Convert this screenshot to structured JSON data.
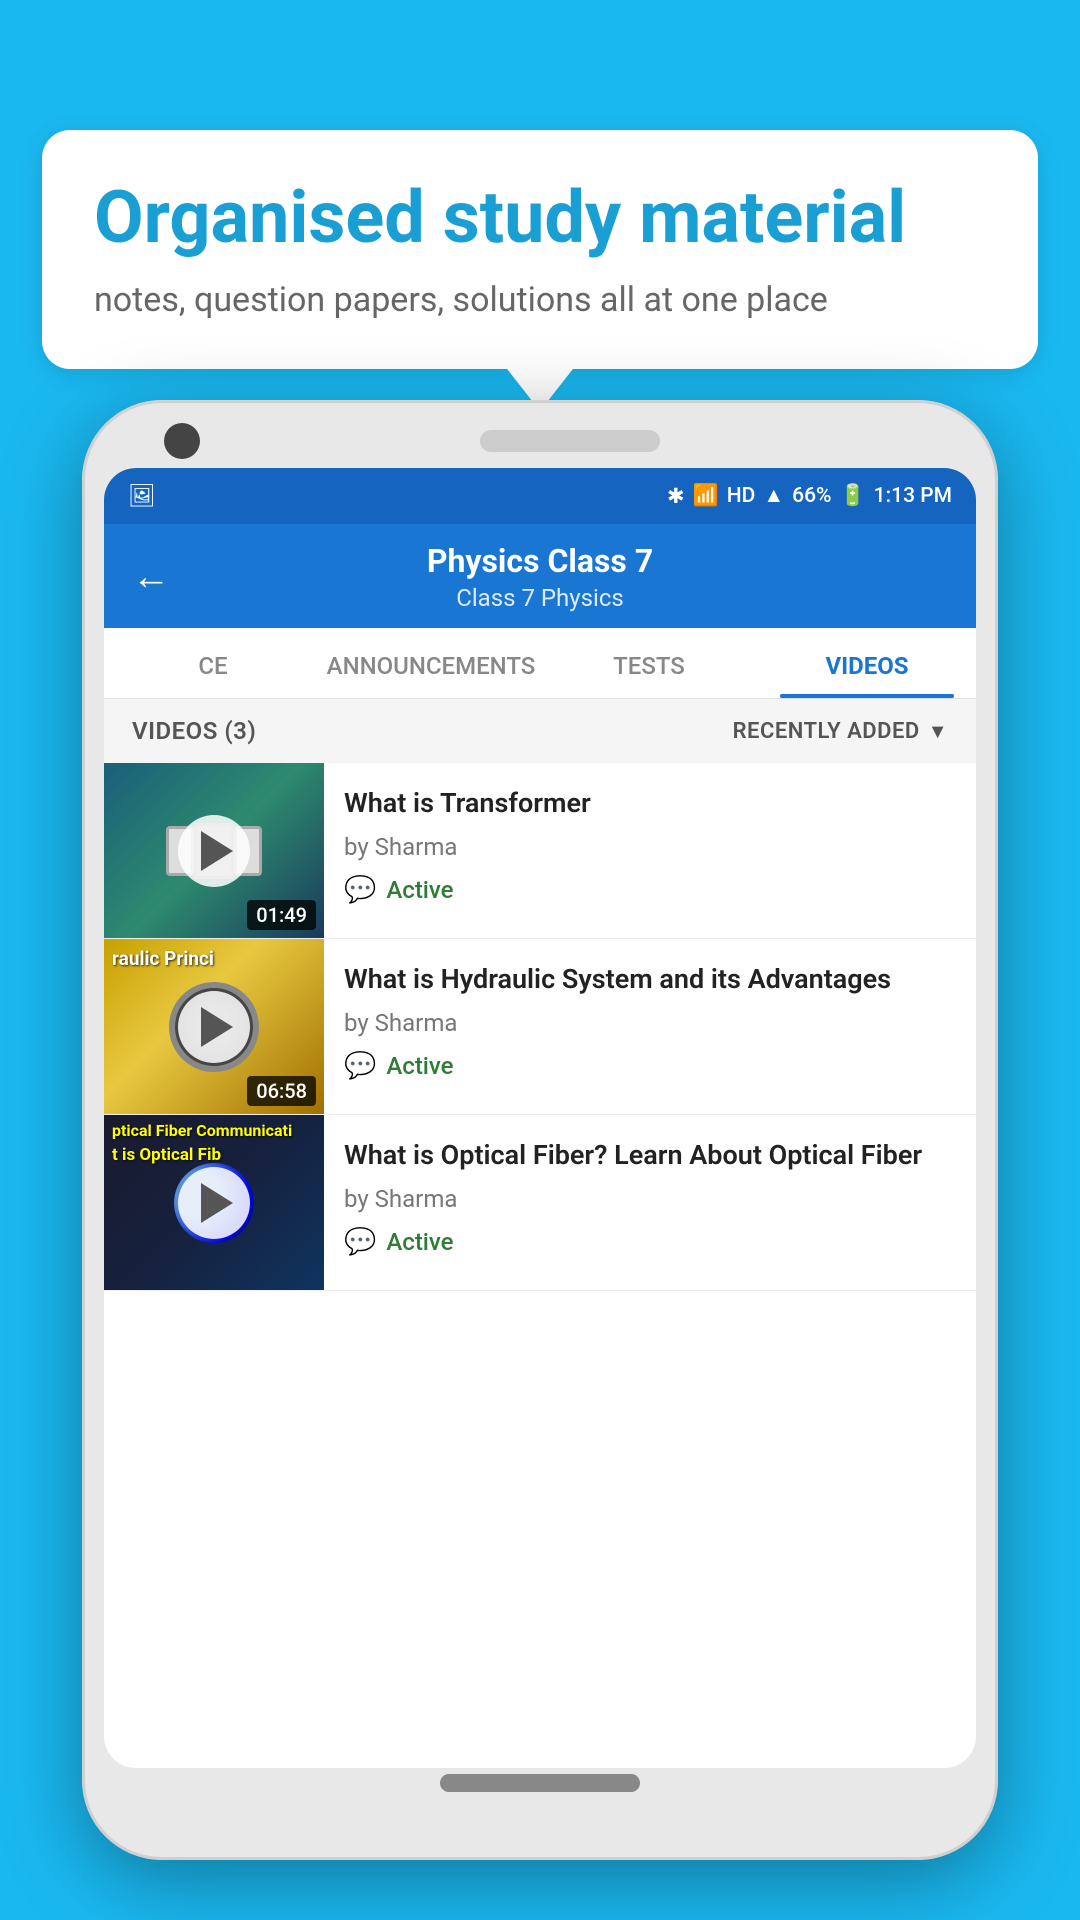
{
  "background_color": "#1ab8f0",
  "speech_bubble": {
    "title": "Organised study material",
    "subtitle": "notes, question papers, solutions all at one place"
  },
  "phone": {
    "status_bar": {
      "time": "1:13 PM",
      "battery": "66%",
      "signal": "HD"
    },
    "header": {
      "back_label": "←",
      "title": "Physics Class 7",
      "breadcrumb": "Class 7    Physics"
    },
    "tabs": [
      {
        "label": "CE",
        "active": false
      },
      {
        "label": "ANNOUNCEMENTS",
        "active": false
      },
      {
        "label": "TESTS",
        "active": false
      },
      {
        "label": "VIDEOS",
        "active": true
      }
    ],
    "filter_bar": {
      "count_label": "VIDEOS (3)",
      "sort_label": "RECENTLY ADDED"
    },
    "videos": [
      {
        "title": "What is  Transformer",
        "author": "by Sharma",
        "status": "Active",
        "duration": "01:49",
        "thumbnail_type": "transformer"
      },
      {
        "title": "What is Hydraulic System and its Advantages",
        "author": "by Sharma",
        "status": "Active",
        "duration": "06:58",
        "thumbnail_type": "hydraulic",
        "thumbnail_text": "raulic Princi"
      },
      {
        "title": "What is Optical Fiber? Learn About Optical Fiber",
        "author": "by Sharma",
        "status": "Active",
        "duration": "",
        "thumbnail_type": "optical",
        "thumbnail_text": "ptical Fiber Communicati",
        "thumbnail_text2": "t is Optical Fib"
      }
    ]
  }
}
